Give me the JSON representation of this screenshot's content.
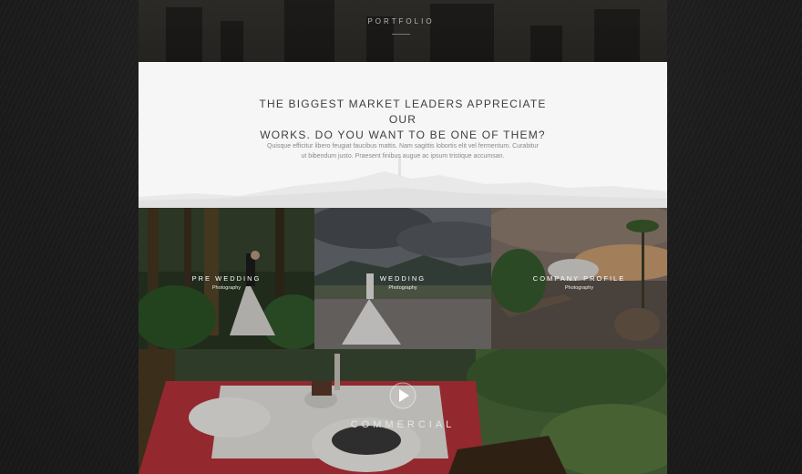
{
  "header": {
    "label": "PORTFOLIO"
  },
  "intro": {
    "heading_line1": "THE BIGGEST MARKET LEADERS APPRECIATE OUR",
    "heading_line2": "WORKS. DO YOU WANT TO BE ONE OF THEM?",
    "text_line1": "Quisque efficitur libero feugiat faucibus mattis. Nam sagittis lobortis elit vel fermentum. Curabitur",
    "text_line2": "ut bibendum justo. Praesent finibus augue ac ipsum tristique accumsan."
  },
  "portfolio": {
    "items": [
      {
        "title": "PRE WEDDING",
        "subtitle": "Photography"
      },
      {
        "title": "WEDDING",
        "subtitle": "Photography"
      },
      {
        "title": "COMPANY PROFILE",
        "subtitle": "Photography"
      }
    ],
    "commercial": {
      "title": "COMMERCIAL",
      "icon": "play-icon"
    }
  },
  "colors": {
    "page_bg": "#1f1f1f",
    "panel_bg": "#f6f6f6",
    "heading": "#3e3e3e",
    "body_text": "#8a8a8a",
    "accent_red": "#b8323a"
  }
}
